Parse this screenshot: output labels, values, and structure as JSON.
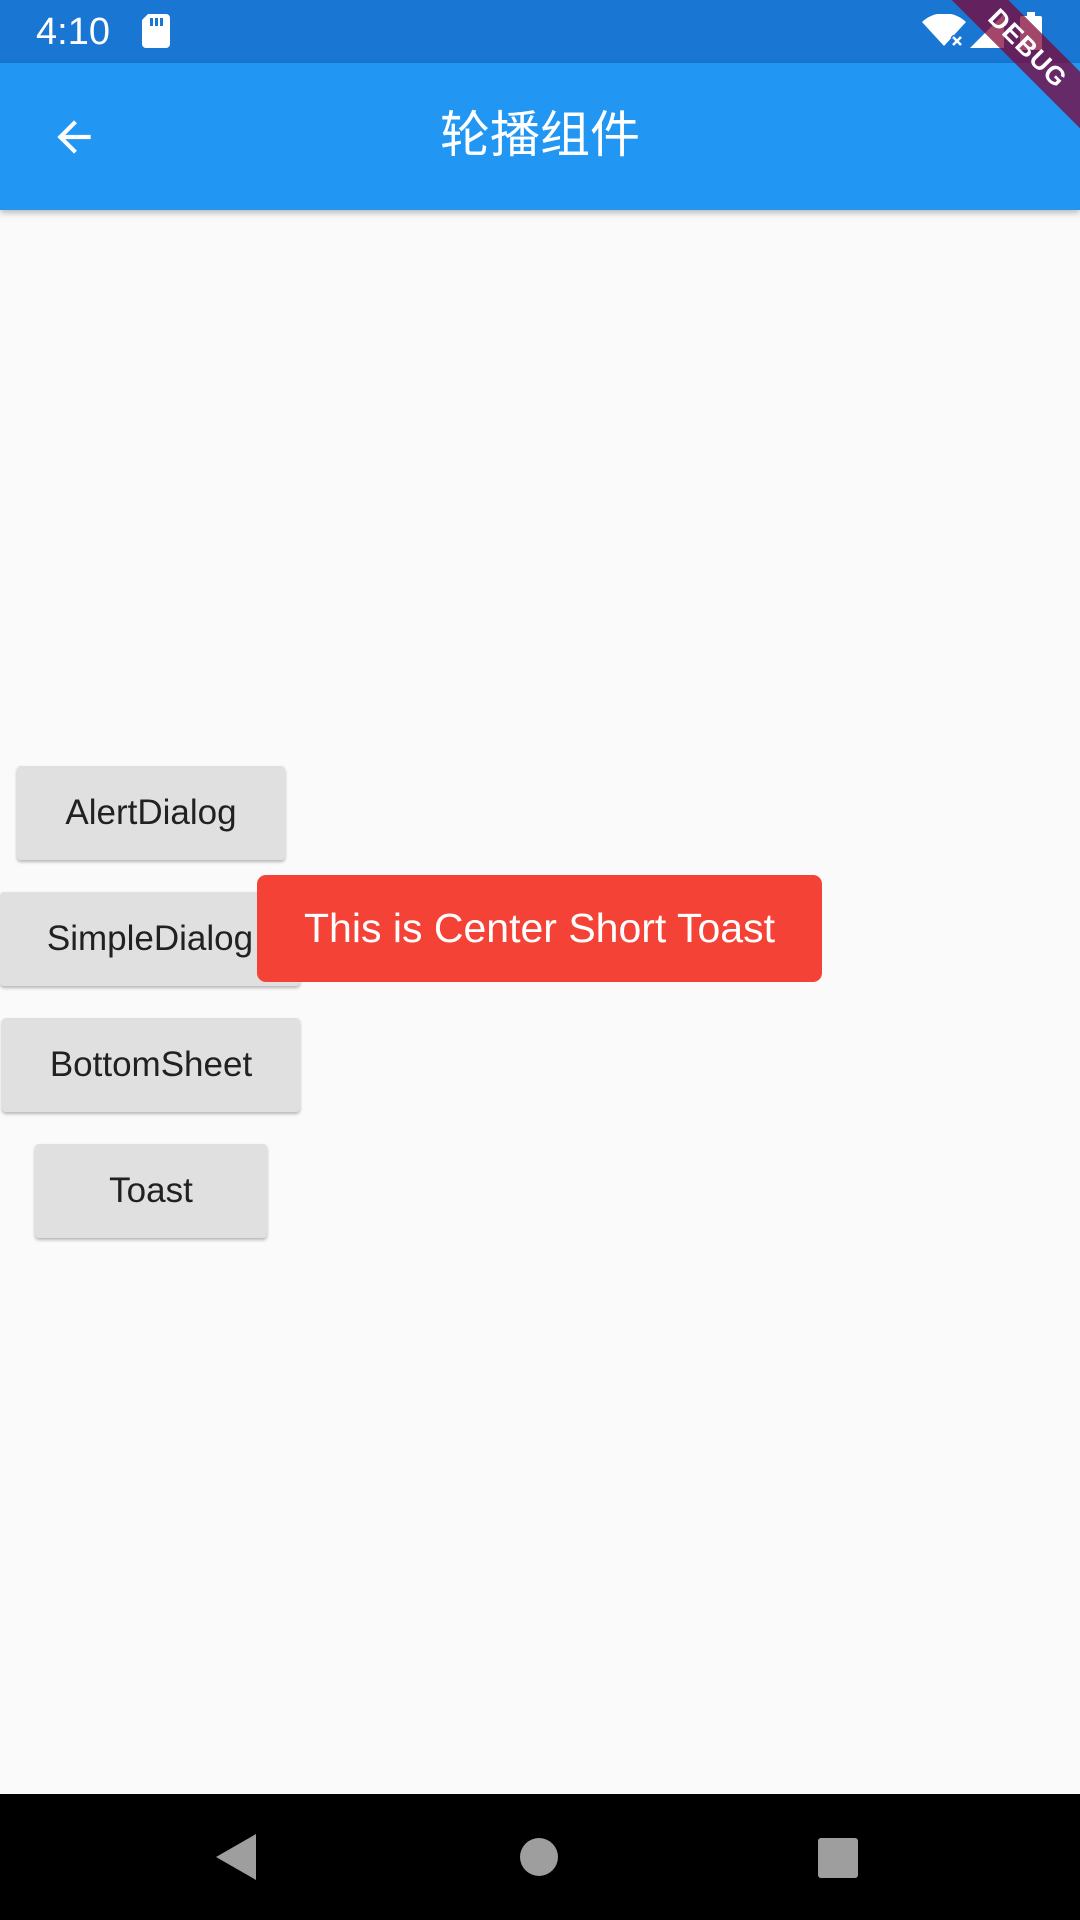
{
  "status_bar": {
    "time": "4:10",
    "icons": [
      "sd-card-icon",
      "wifi-icon",
      "signal-icon",
      "battery-icon"
    ],
    "background": "#1976d2"
  },
  "app_bar": {
    "title": "轮播组件",
    "back_icon": "arrow-back-icon",
    "background": "#2196f3"
  },
  "debug_banner": {
    "label": "DEBUG"
  },
  "buttons": [
    {
      "label": "AlertDialog"
    },
    {
      "label": "SimpleDialog"
    },
    {
      "label": "BottomSheet"
    },
    {
      "label": "Toast"
    }
  ],
  "toast": {
    "message": "This is Center Short Toast",
    "background": "#f44336"
  },
  "nav_bar": {
    "icons": [
      "nav-back-icon",
      "nav-home-icon",
      "nav-recents-icon"
    ]
  }
}
